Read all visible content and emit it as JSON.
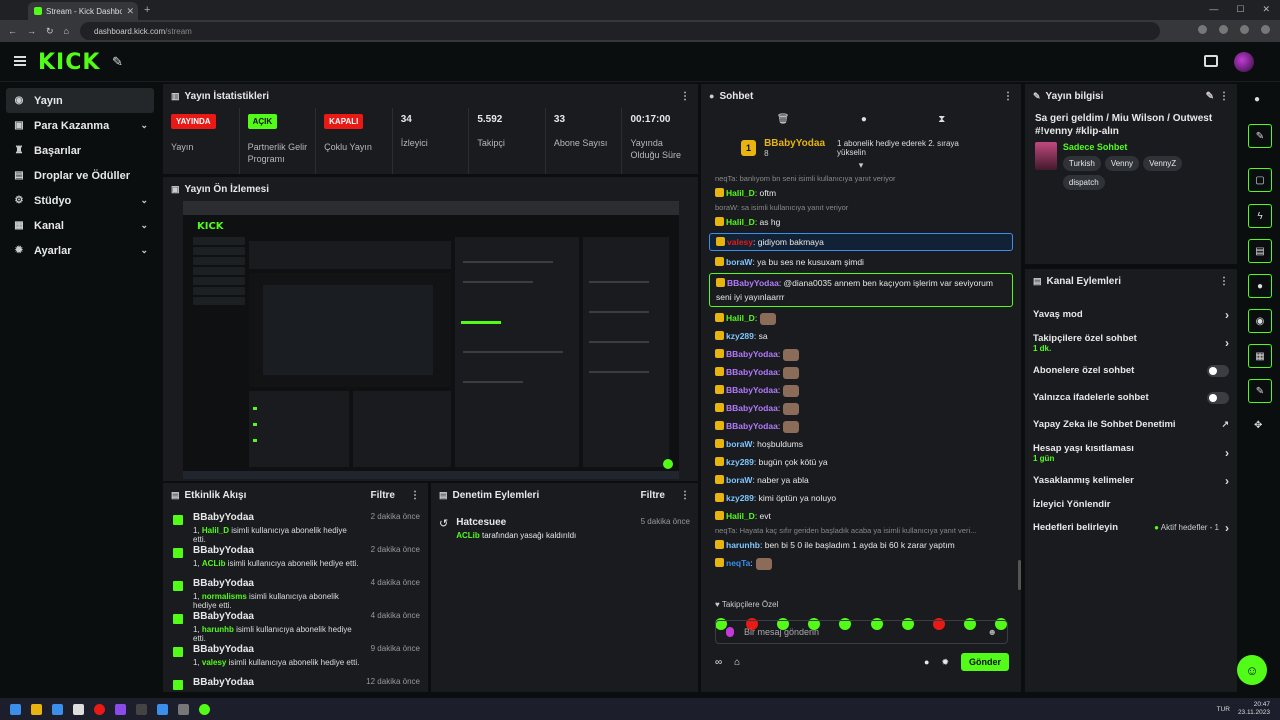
{
  "browser": {
    "tab_title": "Stream - Kick Dashboard",
    "url_host": "dashboard.kick.com",
    "url_path": "/stream"
  },
  "app": {
    "logo": "KICK"
  },
  "sidebar": {
    "items": [
      {
        "label": "Yayın",
        "icon": "stream-icon"
      },
      {
        "label": "Para Kazanma",
        "icon": "wallet-icon"
      },
      {
        "label": "Başarılar",
        "icon": "trophy-icon"
      },
      {
        "label": "Droplar ve Ödüller",
        "icon": "gift-icon"
      },
      {
        "label": "Stüdyo",
        "icon": "studio-icon"
      },
      {
        "label": "Kanal",
        "icon": "channel-icon"
      },
      {
        "label": "Ayarlar",
        "icon": "gear-icon"
      }
    ]
  },
  "stats": {
    "title": "Yayın İstatistikleri",
    "cells": [
      {
        "value": "YAYINDA",
        "label": "Yayın",
        "kind": "red"
      },
      {
        "value": "AÇIK",
        "label": "Partnerlik Gelir Programı",
        "kind": "green"
      },
      {
        "value": "KAPALI",
        "label": "Çoklu Yayın",
        "kind": "red"
      },
      {
        "value": "34",
        "label": "İzleyici",
        "kind": "num"
      },
      {
        "value": "5.592",
        "label": "Takipçi",
        "kind": "num"
      },
      {
        "value": "33",
        "label": "Abone Sayısı",
        "kind": "num"
      },
      {
        "value": "00:17:00",
        "label": "Yayında Olduğu Süre",
        "kind": "num"
      }
    ]
  },
  "preview": {
    "title": "Yayın Ön İzlemesi"
  },
  "activity": {
    "title": "Etkinlik Akışı",
    "filter": "Filtre",
    "items": [
      {
        "name": "BBabyYodaa",
        "detail_pre": "1, ",
        "detail_user": "Halil_D",
        "detail_post": " isimli kullanıcıya abonelik hediye etti.",
        "time": "2 dakika önce"
      },
      {
        "name": "BBabyYodaa",
        "detail_pre": "1, ",
        "detail_user": "ACLib",
        "detail_post": " isimli kullanıcıya abonelik hediye etti.",
        "time": "2 dakika önce"
      },
      {
        "name": "BBabyYodaa",
        "detail_pre": "1, ",
        "detail_user": "normalisms",
        "detail_post": " isimli kullanıcıya abonelik hediye etti.",
        "time": "4 dakika önce"
      },
      {
        "name": "BBabyYodaa",
        "detail_pre": "1, ",
        "detail_user": "harunhb",
        "detail_post": " isimli kullanıcıya abonelik hediye etti.",
        "time": "4 dakika önce"
      },
      {
        "name": "BBabyYodaa",
        "detail_pre": "1, ",
        "detail_user": "valesy",
        "detail_post": " isimli kullanıcıya abonelik hediye etti.",
        "time": "9 dakika önce"
      },
      {
        "name": "BBabyYodaa",
        "detail_pre": "",
        "detail_user": "",
        "detail_post": "",
        "time": "12 dakika önce"
      }
    ]
  },
  "moderation": {
    "title": "Denetim Eylemleri",
    "filter": "Filtre",
    "items": [
      {
        "name": "Hatcesuee",
        "actor": "ACLib",
        "detail": " tarafından yasağı kaldırıldı",
        "time": "5 dakika önce"
      }
    ]
  },
  "chat": {
    "title": "Sohbet",
    "pinned": {
      "name": "BBabyYodaa",
      "sub": "8",
      "message": "1 abonelik hediye ederek 2. sıraya yükselin"
    },
    "messages": [
      {
        "type": "reply",
        "text": "neqTa: banlıyom bn seni isimli kullanıcıya yanıt veriyor"
      },
      {
        "type": "msg",
        "user": "Halil_D",
        "color": "#53fc18",
        "text": ": oftm"
      },
      {
        "type": "reply",
        "text": "boraW: sa isimli kullanıcıya yanıt veriyor"
      },
      {
        "type": "msg",
        "user": "Halil_D",
        "color": "#53fc18",
        "text": ": as hg"
      },
      {
        "type": "hl2",
        "user": "valesy",
        "color": "#e91916",
        "text": ": gidiyom bakmaya"
      },
      {
        "type": "msg",
        "user": "boraW",
        "color": "#7ec7ff",
        "text": ": ya bu ses ne kusuxam şimdi"
      },
      {
        "type": "hl",
        "user": "BBabyYodaa",
        "color": "#b57aff",
        "text": ": @diana0035 annem ben kaçıyom işlerim var seviyorum seni iyi yayınlaarrr"
      },
      {
        "type": "msg",
        "user": "Halil_D",
        "color": "#53fc18",
        "text": ":",
        "emote": true
      },
      {
        "type": "msg",
        "user": "kzy289",
        "color": "#7ec7ff",
        "text": ": sa"
      },
      {
        "type": "msg",
        "user": "BBabyYodaa",
        "color": "#b57aff",
        "text": ":",
        "emote": true
      },
      {
        "type": "msg",
        "user": "BBabyYodaa",
        "color": "#b57aff",
        "text": ":",
        "emote": true
      },
      {
        "type": "msg",
        "user": "BBabyYodaa",
        "color": "#b57aff",
        "text": ":",
        "emote": true
      },
      {
        "type": "msg",
        "user": "BBabyYodaa",
        "color": "#b57aff",
        "text": ":",
        "emote": true
      },
      {
        "type": "msg",
        "user": "BBabyYodaa",
        "color": "#b57aff",
        "text": ":",
        "emote": true
      },
      {
        "type": "msg",
        "user": "boraW",
        "color": "#7ec7ff",
        "text": ": hoşbuldums"
      },
      {
        "type": "msg",
        "user": "kzy289",
        "color": "#7ec7ff",
        "text": ": bugün çok kötü ya"
      },
      {
        "type": "msg",
        "user": "boraW",
        "color": "#7ec7ff",
        "text": ": naber ya abla"
      },
      {
        "type": "msg",
        "user": "kzy289",
        "color": "#7ec7ff",
        "text": ": kimi öptün ya noluyo"
      },
      {
        "type": "msg",
        "user": "Halil_D",
        "color": "#53fc18",
        "text": ": evt"
      },
      {
        "type": "reply",
        "text": "neqTa: Hayata kaç sıfır geriden başladık acaba ya isimli kullanıcıya yanıt veri..."
      },
      {
        "type": "msg",
        "user": "harunhb",
        "color": "#7ec7ff",
        "text": ": ben bi 5 0 ile başladım 1 ayda bi 60 k zarar yaptım"
      },
      {
        "type": "msg",
        "user": "neqTa",
        "color": "#3b8eea",
        "text": ":",
        "emote": true
      }
    ],
    "followers_label": "Takipçilere Özel",
    "input_placeholder": "Bir mesaj gönderin",
    "send_label": "Gönder"
  },
  "stream_info": {
    "title": "Yayın bilgisi",
    "stream_title": "Sa geri geldim / Miu Wilson / Outwest #!venny #klip-alın",
    "category": "Sadece Sohbet",
    "tags": [
      "Turkish",
      "Venny",
      "VennyZ",
      "dispatch"
    ]
  },
  "channel_actions": {
    "title": "Kanal Eylemleri",
    "rows": [
      {
        "label": "Yavaş mod",
        "sub": "",
        "control": "arrow"
      },
      {
        "label": "Takipçilere özel sohbet",
        "sub": "1 dk.",
        "control": "arrow"
      },
      {
        "label": "Abonelere özel sohbet",
        "sub": "",
        "control": "toggle"
      },
      {
        "label": "Yalnızca ifadelerle sohbet",
        "sub": "",
        "control": "toggle"
      },
      {
        "label": "Yapay Zeka ile Sohbet Denetimi",
        "sub": "",
        "control": "external"
      },
      {
        "label": "Hesap yaşı kısıtlaması",
        "sub": "1 gün",
        "control": "arrow"
      },
      {
        "label": "Yasaklanmış kelimeler",
        "sub": "",
        "control": "arrow"
      },
      {
        "label": "İzleyici Yönlendir",
        "sub": "",
        "control": "none"
      },
      {
        "label": "Hedefleri belirleyin",
        "sub": "",
        "control": "arrow",
        "meta_pre": "Aktif hedefler - ",
        "meta_val": "1"
      }
    ]
  },
  "taskbar": {
    "time": "20:47",
    "date": "23.11.2023",
    "lang": "TUR"
  },
  "colors": {
    "accent": "#53fc18",
    "live_red": "#e91916",
    "panel": "#191b1f",
    "bg": "#0b0e0f"
  }
}
